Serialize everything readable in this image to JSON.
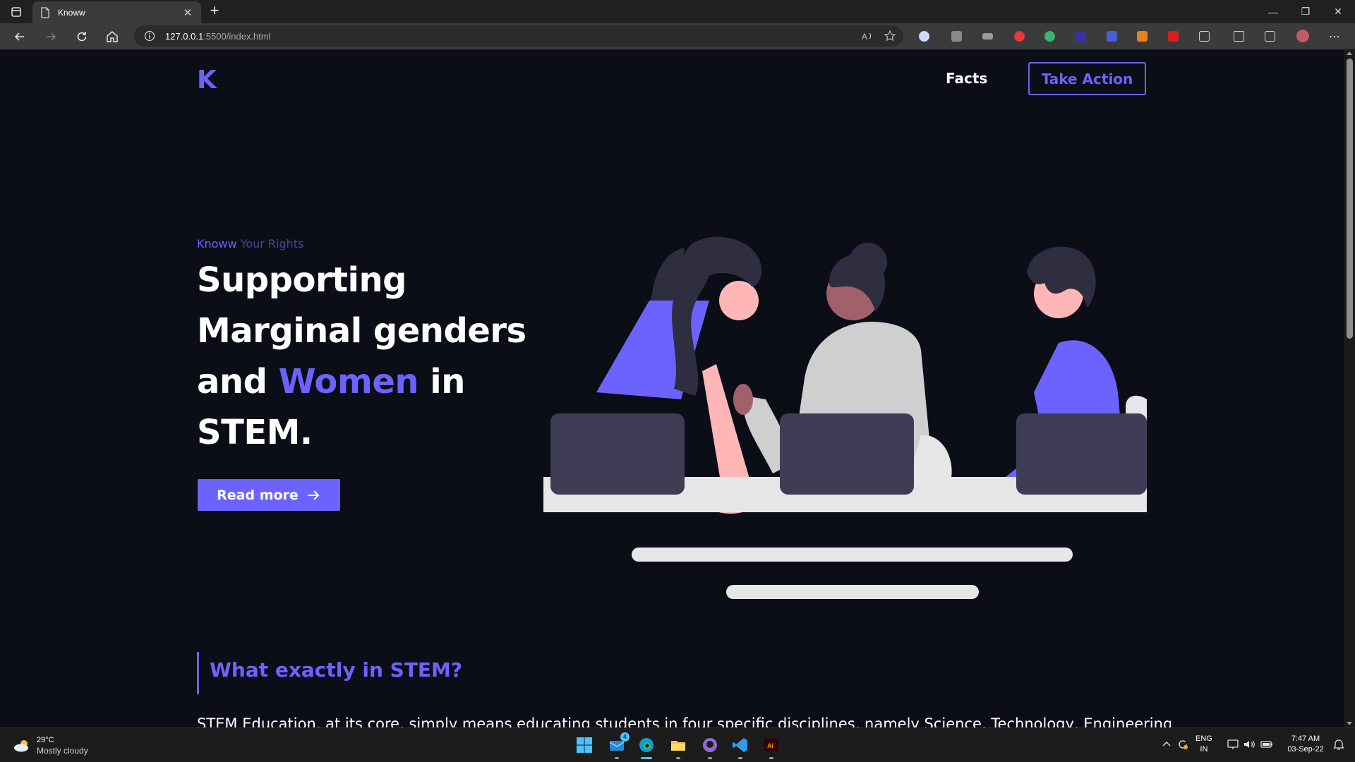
{
  "browser": {
    "tab_title": "Knoww",
    "tab_close": "✕",
    "new_tab": "+",
    "url_host": "127.0.0.1",
    "url_rest": ":5500/index.html"
  },
  "window_controls": {
    "minimize": "—",
    "restore": "❐",
    "close": "✕"
  },
  "page": {
    "logo": "K",
    "nav": {
      "facts": "Facts",
      "take_action": "Take Action"
    },
    "hero": {
      "eyebrow_brand": "Knoww",
      "eyebrow_rest": " Your Rights",
      "headline_line1": "Supporting",
      "headline_line2": "Marginal genders",
      "headline_and": "and ",
      "headline_accent": "Women",
      "headline_in": " in",
      "headline_line4": "STEM.",
      "cta": "Read more"
    },
    "section": {
      "title": "What exactly in STEM?",
      "text": "STEM Education, at its core, simply means educating students in four specific disciplines, namely Science, Technology, Engineering, and"
    }
  },
  "taskbar": {
    "weather_temp": "29°C",
    "weather_cond": "Mostly cloudy",
    "lang_top": "ENG",
    "lang_bottom": "IN",
    "time": "7:47 AM",
    "date": "03-Sep-22",
    "mail_badge": "4"
  },
  "colors": {
    "accent": "#6c63ff",
    "page_bg": "#0b0d17",
    "chrome_bg": "#202020",
    "toolbar_bg": "#3b3b3b"
  }
}
